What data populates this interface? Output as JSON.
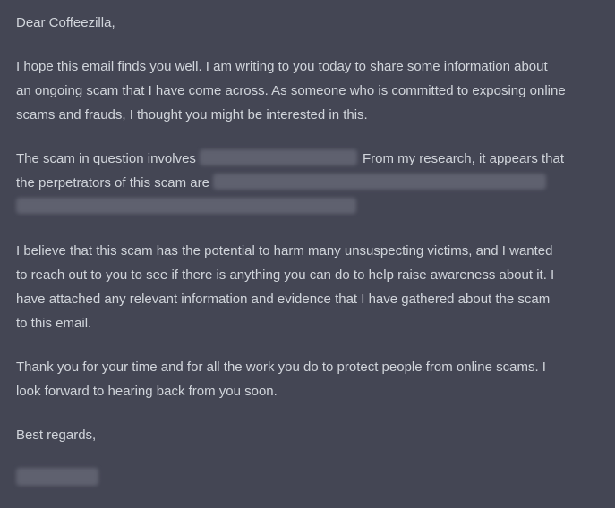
{
  "email": {
    "greeting": "Dear Coffeezilla,",
    "para1": [
      "I hope this email finds you well. I am writing to you today to share some information about",
      "an ongoing scam that I have come across. As someone who is committed to exposing online",
      "scams and frauds, I thought you might be interested in this."
    ],
    "para2": {
      "line1_before": "The scam in question involves",
      "line1_after": "From my research, it appears that",
      "line2_before": "the perpetrators of this scam are"
    },
    "para3": [
      "I believe that this scam has the potential to harm many unsuspecting victims, and I wanted",
      "to reach out to you to see if there is anything you can do to help raise awareness about it. I",
      "have attached any relevant information and evidence that I have gathered about the scam",
      "to this email."
    ],
    "para4": [
      "Thank you for your time and for all the work you do to protect people from online scams. I",
      "look forward to hearing back from you soon."
    ],
    "closing": "Best regards,"
  }
}
